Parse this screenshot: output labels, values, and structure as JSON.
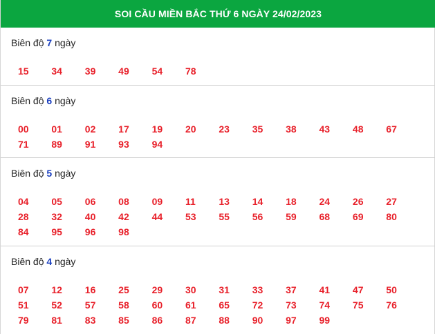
{
  "header": {
    "title": "SOI CẦU MIỀN BẮC THỨ 6 NGÀY 24/02/2023"
  },
  "sections": [
    {
      "prefix": "Biên độ",
      "days": "7",
      "suffix": "ngày",
      "numbers": [
        "15",
        "34",
        "39",
        "49",
        "54",
        "78"
      ]
    },
    {
      "prefix": "Biên độ",
      "days": "6",
      "suffix": "ngày",
      "numbers": [
        "00",
        "01",
        "02",
        "17",
        "19",
        "20",
        "23",
        "35",
        "38",
        "43",
        "48",
        "67",
        "71",
        "89",
        "91",
        "93",
        "94"
      ]
    },
    {
      "prefix": "Biên độ",
      "days": "5",
      "suffix": "ngày",
      "numbers": [
        "04",
        "05",
        "06",
        "08",
        "09",
        "11",
        "13",
        "14",
        "18",
        "24",
        "26",
        "27",
        "28",
        "32",
        "40",
        "42",
        "44",
        "53",
        "55",
        "56",
        "59",
        "68",
        "69",
        "80",
        "84",
        "95",
        "96",
        "98"
      ]
    },
    {
      "prefix": "Biên độ",
      "days": "4",
      "suffix": "ngày",
      "numbers": [
        "07",
        "12",
        "16",
        "25",
        "29",
        "30",
        "31",
        "33",
        "37",
        "41",
        "47",
        "50",
        "51",
        "52",
        "57",
        "58",
        "60",
        "61",
        "65",
        "72",
        "73",
        "74",
        "75",
        "76",
        "79",
        "81",
        "83",
        "85",
        "86",
        "87",
        "88",
        "90",
        "97",
        "99"
      ]
    }
  ],
  "colors": {
    "header_bg": "#0ba640",
    "number": "#e8202a",
    "day_count": "#1a3fbf"
  }
}
